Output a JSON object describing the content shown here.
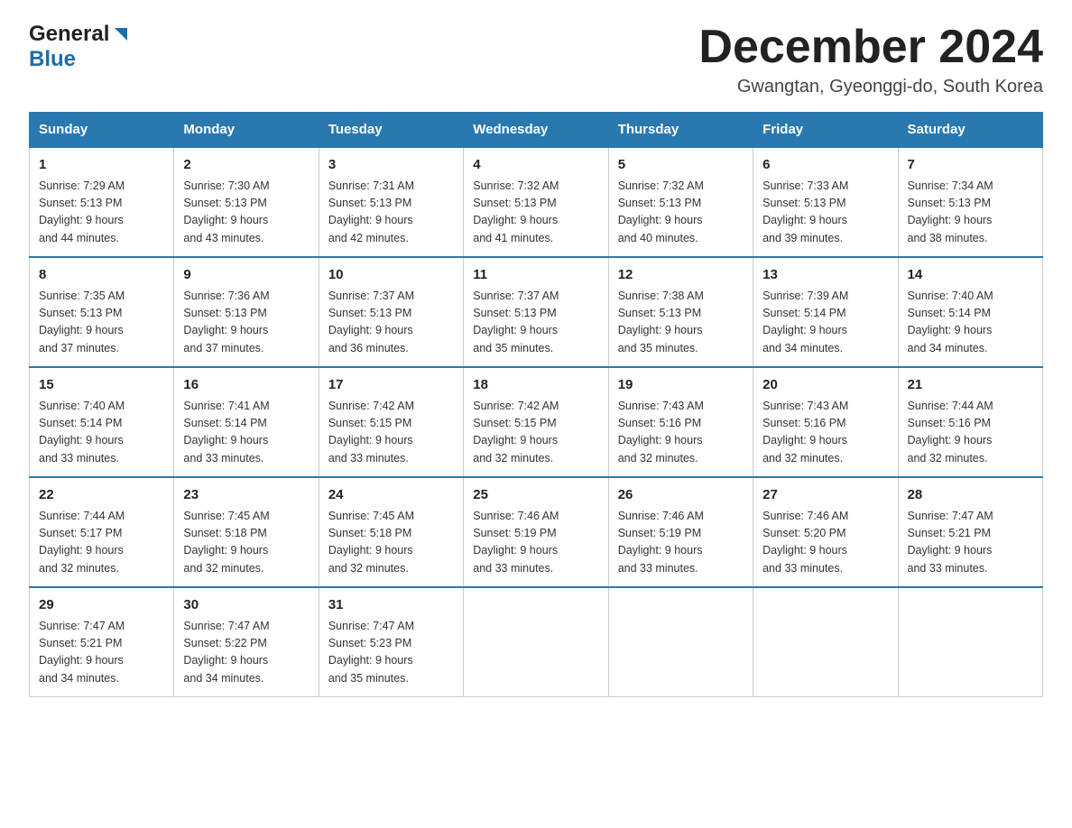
{
  "header": {
    "logo_general": "General",
    "logo_blue": "Blue",
    "month_title": "December 2024",
    "location": "Gwangtan, Gyeonggi-do, South Korea"
  },
  "weekdays": [
    "Sunday",
    "Monday",
    "Tuesday",
    "Wednesday",
    "Thursday",
    "Friday",
    "Saturday"
  ],
  "weeks": [
    [
      {
        "day": "1",
        "sunrise": "7:29 AM",
        "sunset": "5:13 PM",
        "daylight": "9 hours and 44 minutes."
      },
      {
        "day": "2",
        "sunrise": "7:30 AM",
        "sunset": "5:13 PM",
        "daylight": "9 hours and 43 minutes."
      },
      {
        "day": "3",
        "sunrise": "7:31 AM",
        "sunset": "5:13 PM",
        "daylight": "9 hours and 42 minutes."
      },
      {
        "day": "4",
        "sunrise": "7:32 AM",
        "sunset": "5:13 PM",
        "daylight": "9 hours and 41 minutes."
      },
      {
        "day": "5",
        "sunrise": "7:32 AM",
        "sunset": "5:13 PM",
        "daylight": "9 hours and 40 minutes."
      },
      {
        "day": "6",
        "sunrise": "7:33 AM",
        "sunset": "5:13 PM",
        "daylight": "9 hours and 39 minutes."
      },
      {
        "day": "7",
        "sunrise": "7:34 AM",
        "sunset": "5:13 PM",
        "daylight": "9 hours and 38 minutes."
      }
    ],
    [
      {
        "day": "8",
        "sunrise": "7:35 AM",
        "sunset": "5:13 PM",
        "daylight": "9 hours and 37 minutes."
      },
      {
        "day": "9",
        "sunrise": "7:36 AM",
        "sunset": "5:13 PM",
        "daylight": "9 hours and 37 minutes."
      },
      {
        "day": "10",
        "sunrise": "7:37 AM",
        "sunset": "5:13 PM",
        "daylight": "9 hours and 36 minutes."
      },
      {
        "day": "11",
        "sunrise": "7:37 AM",
        "sunset": "5:13 PM",
        "daylight": "9 hours and 35 minutes."
      },
      {
        "day": "12",
        "sunrise": "7:38 AM",
        "sunset": "5:13 PM",
        "daylight": "9 hours and 35 minutes."
      },
      {
        "day": "13",
        "sunrise": "7:39 AM",
        "sunset": "5:14 PM",
        "daylight": "9 hours and 34 minutes."
      },
      {
        "day": "14",
        "sunrise": "7:40 AM",
        "sunset": "5:14 PM",
        "daylight": "9 hours and 34 minutes."
      }
    ],
    [
      {
        "day": "15",
        "sunrise": "7:40 AM",
        "sunset": "5:14 PM",
        "daylight": "9 hours and 33 minutes."
      },
      {
        "day": "16",
        "sunrise": "7:41 AM",
        "sunset": "5:14 PM",
        "daylight": "9 hours and 33 minutes."
      },
      {
        "day": "17",
        "sunrise": "7:42 AM",
        "sunset": "5:15 PM",
        "daylight": "9 hours and 33 minutes."
      },
      {
        "day": "18",
        "sunrise": "7:42 AM",
        "sunset": "5:15 PM",
        "daylight": "9 hours and 32 minutes."
      },
      {
        "day": "19",
        "sunrise": "7:43 AM",
        "sunset": "5:16 PM",
        "daylight": "9 hours and 32 minutes."
      },
      {
        "day": "20",
        "sunrise": "7:43 AM",
        "sunset": "5:16 PM",
        "daylight": "9 hours and 32 minutes."
      },
      {
        "day": "21",
        "sunrise": "7:44 AM",
        "sunset": "5:16 PM",
        "daylight": "9 hours and 32 minutes."
      }
    ],
    [
      {
        "day": "22",
        "sunrise": "7:44 AM",
        "sunset": "5:17 PM",
        "daylight": "9 hours and 32 minutes."
      },
      {
        "day": "23",
        "sunrise": "7:45 AM",
        "sunset": "5:18 PM",
        "daylight": "9 hours and 32 minutes."
      },
      {
        "day": "24",
        "sunrise": "7:45 AM",
        "sunset": "5:18 PM",
        "daylight": "9 hours and 32 minutes."
      },
      {
        "day": "25",
        "sunrise": "7:46 AM",
        "sunset": "5:19 PM",
        "daylight": "9 hours and 33 minutes."
      },
      {
        "day": "26",
        "sunrise": "7:46 AM",
        "sunset": "5:19 PM",
        "daylight": "9 hours and 33 minutes."
      },
      {
        "day": "27",
        "sunrise": "7:46 AM",
        "sunset": "5:20 PM",
        "daylight": "9 hours and 33 minutes."
      },
      {
        "day": "28",
        "sunrise": "7:47 AM",
        "sunset": "5:21 PM",
        "daylight": "9 hours and 33 minutes."
      }
    ],
    [
      {
        "day": "29",
        "sunrise": "7:47 AM",
        "sunset": "5:21 PM",
        "daylight": "9 hours and 34 minutes."
      },
      {
        "day": "30",
        "sunrise": "7:47 AM",
        "sunset": "5:22 PM",
        "daylight": "9 hours and 34 minutes."
      },
      {
        "day": "31",
        "sunrise": "7:47 AM",
        "sunset": "5:23 PM",
        "daylight": "9 hours and 35 minutes."
      },
      null,
      null,
      null,
      null
    ]
  ],
  "labels": {
    "sunrise": "Sunrise:",
    "sunset": "Sunset:",
    "daylight": "Daylight:"
  }
}
